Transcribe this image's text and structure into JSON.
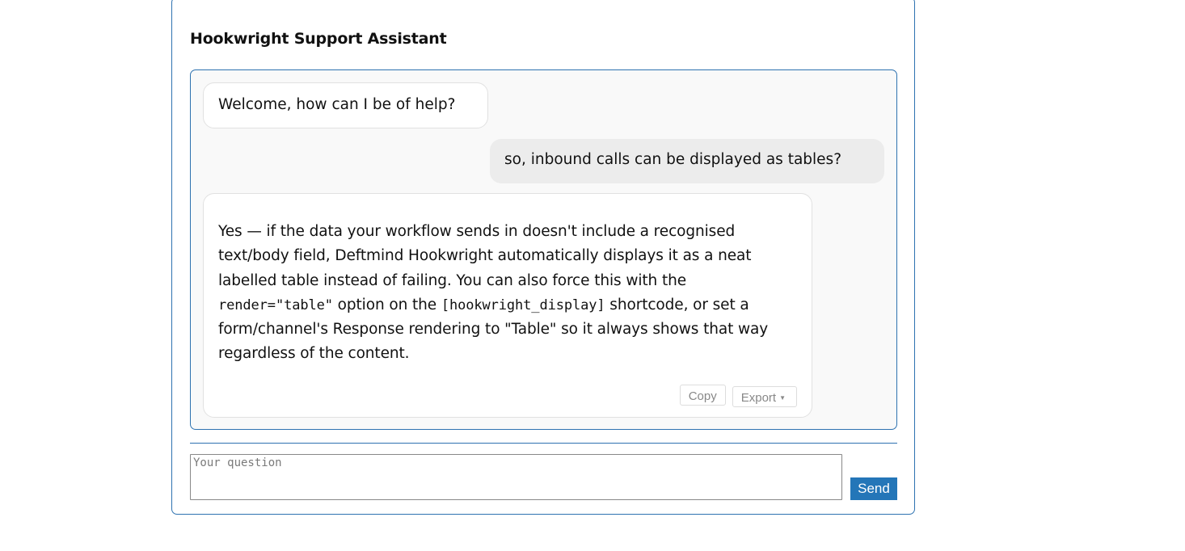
{
  "assistant": {
    "title": "Hookwright Support Assistant"
  },
  "messages": [
    {
      "role": "assistant",
      "text": "Welcome, how can I be of help?"
    },
    {
      "role": "user",
      "text": "so, inbound calls can be displayed as tables?"
    },
    {
      "role": "assistant",
      "segments": {
        "part1": "Yes — if the data your workflow sends in doesn't include a recognised text/body field, Deftmind Hookwright automatically displays it as a neat labelled table instead of failing. You can also force this with the ",
        "code1": "render=\"table\"",
        "part2": " option on the ",
        "code2": "[hookwright_display]",
        "part3": " shortcode, or set a form/channel's Response rendering to \"Table\" so it always shows that way regardless of the content."
      },
      "actions": {
        "copy_label": "Copy",
        "export_label": "Export",
        "export_caret": "▼"
      }
    }
  ],
  "composer": {
    "placeholder": "Your question",
    "value": "",
    "send_label": "Send"
  }
}
